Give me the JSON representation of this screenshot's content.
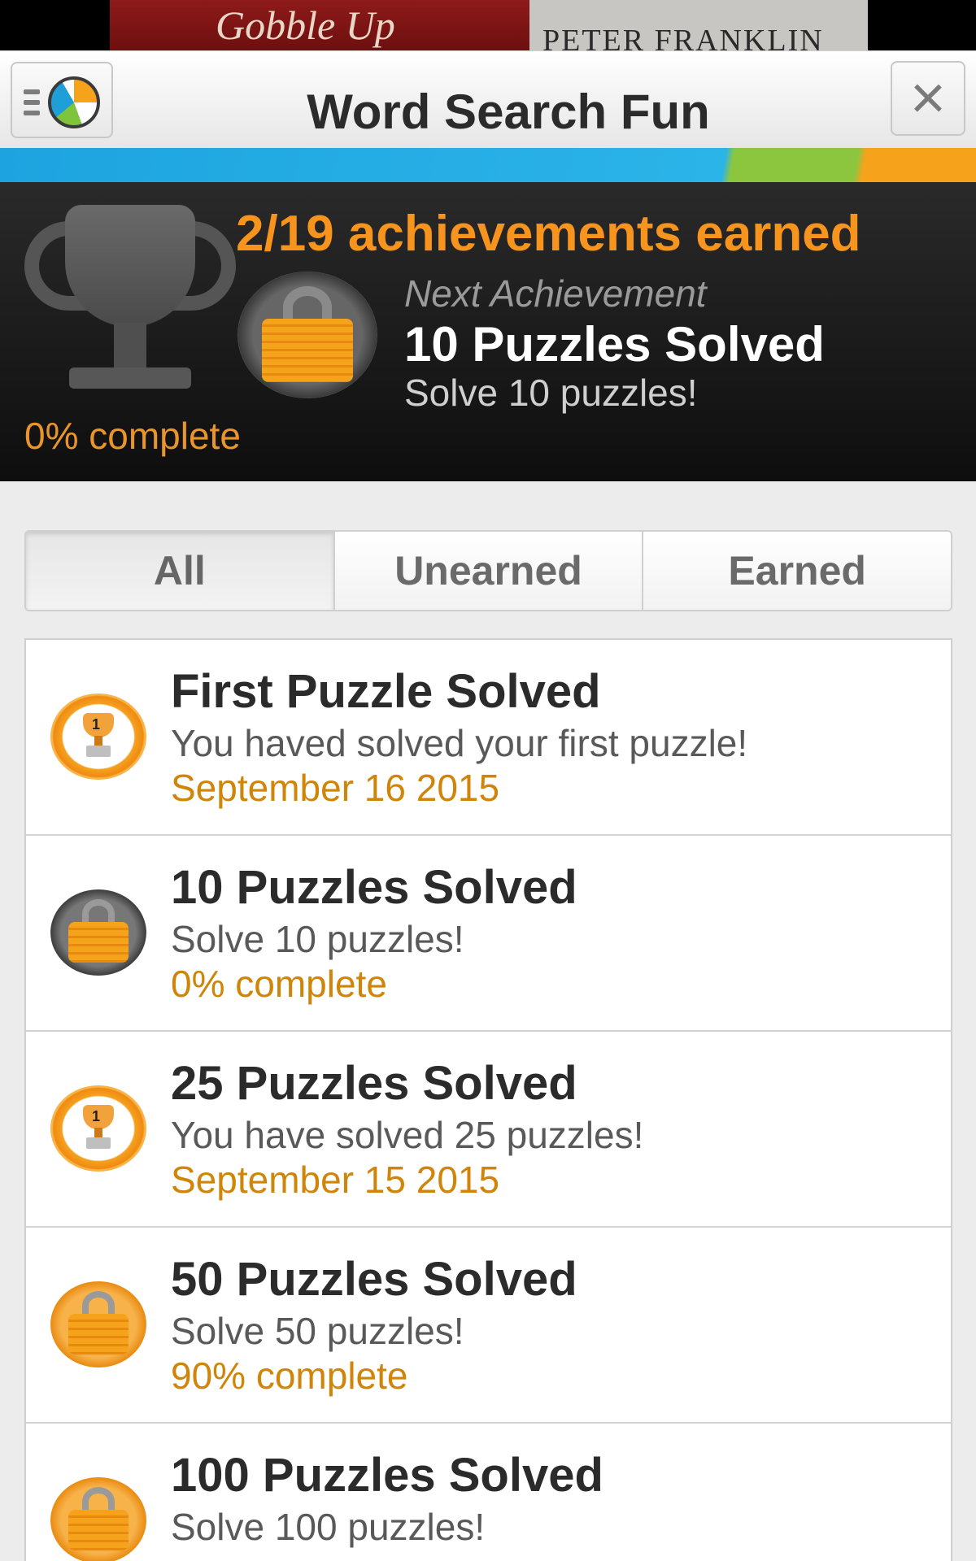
{
  "banner": {
    "left_text": "Gobble Up",
    "right_text": "PETER FRANKLIN"
  },
  "header": {
    "title": "Word Search Fun",
    "close_label": "×"
  },
  "summary": {
    "earned_count": "2/19 achievements earned",
    "next_label": "Next Achievement",
    "next_title": "10 Puzzles Solved",
    "next_desc": "Solve 10 puzzles!",
    "progress": "0% complete"
  },
  "tabs": [
    "All",
    "Unearned",
    "Earned"
  ],
  "achievements": [
    {
      "name": "First Puzzle Solved",
      "desc": "You haved solved your first puzzle!",
      "meta": "September 16 2015",
      "state": "earned"
    },
    {
      "name": "10 Puzzles Solved",
      "desc": "Solve 10 puzzles!",
      "meta": "0% complete",
      "state": "locked"
    },
    {
      "name": "25 Puzzles Solved",
      "desc": "You have solved 25 puzzles!",
      "meta": "September 15 2015",
      "state": "earned"
    },
    {
      "name": "50 Puzzles Solved",
      "desc": "Solve 50 puzzles!",
      "meta": "90% complete",
      "state": "locked"
    },
    {
      "name": "100 Puzzles Solved",
      "desc": "Solve 100 puzzles!",
      "meta": "",
      "state": "locked"
    }
  ],
  "colors": {
    "accent_orange": "#f7941d",
    "stripe_blue": "#1da4e0",
    "stripe_green": "#8cc63f",
    "stripe_orange": "#f7a21b"
  },
  "icons": {
    "menu": "menu-icon",
    "logo": "beach-ball-icon",
    "close": "close-icon",
    "trophy": "trophy-icon",
    "lock": "padlock-icon"
  }
}
